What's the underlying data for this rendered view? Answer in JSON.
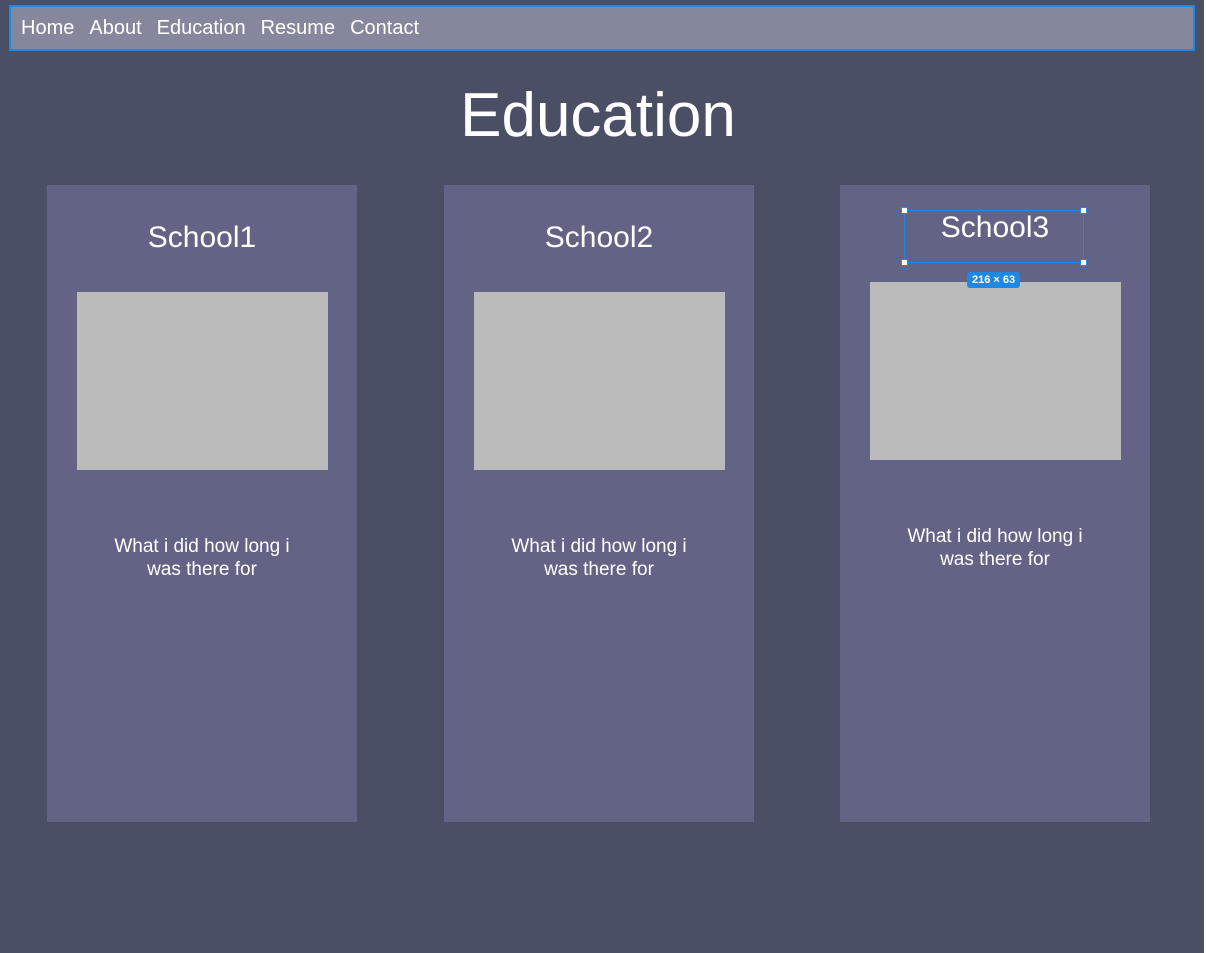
{
  "nav": {
    "items": [
      "Home",
      "About",
      "Education",
      "Resume",
      "Contact"
    ]
  },
  "page": {
    "title": "Education"
  },
  "cards": [
    {
      "title": "School1",
      "description": "What i did how long i was there for"
    },
    {
      "title": "School2",
      "description": "What i did how long i was there for"
    },
    {
      "title": "School3",
      "description": "What i did how long i was there for"
    }
  ],
  "selection": {
    "size_label": "216 × 63"
  },
  "colors": {
    "background": "#4a4f66",
    "nav_background": "#85889d",
    "card_background": "#636485",
    "image_placeholder": "#bbbbbb",
    "selection_accent": "#1e88e5"
  }
}
